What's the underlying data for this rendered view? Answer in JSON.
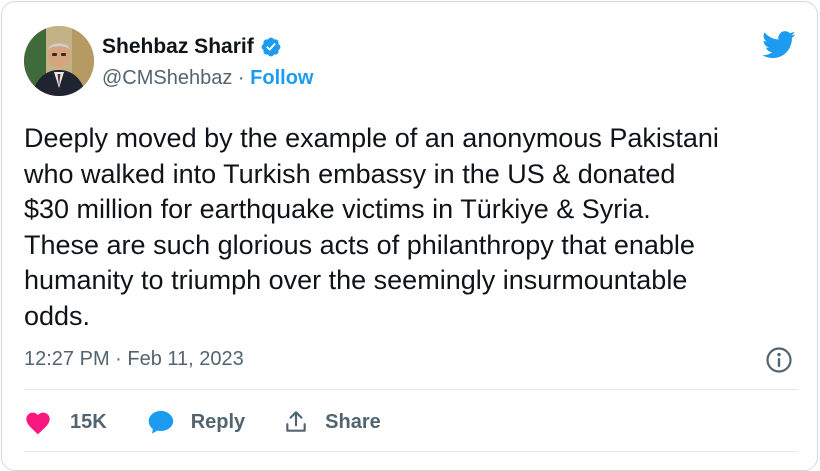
{
  "author": {
    "name": "Shehbaz Sharif",
    "handle": "@CMShehbaz",
    "separator": " · ",
    "follow_label": "Follow",
    "verified": true
  },
  "tweet": {
    "text": "Deeply moved by the example of an anonymous Pakistani\nwho walked into Turkish embassy in the US & donated\n$30 million for earthquake victims in Türkiye & Syria.\nThese are such glorious acts of philanthropy that enable\nhumanity to triumph over the seemingly insurmountable\nodds.",
    "timestamp": "12:27 PM · Feb 11, 2023"
  },
  "actions": {
    "like_count": "15K",
    "reply_label": "Reply",
    "share_label": "Share"
  },
  "icons": {
    "verified": "verified-badge-icon",
    "brand": "twitter-bird-icon",
    "info": "info-icon",
    "like": "heart-icon",
    "reply": "speech-bubble-icon",
    "share": "share-upload-icon"
  },
  "colors": {
    "accent": "#1d9bf0",
    "like": "#f91880",
    "text": "#0f1419",
    "muted": "#536471",
    "border": "#cfd9de"
  }
}
